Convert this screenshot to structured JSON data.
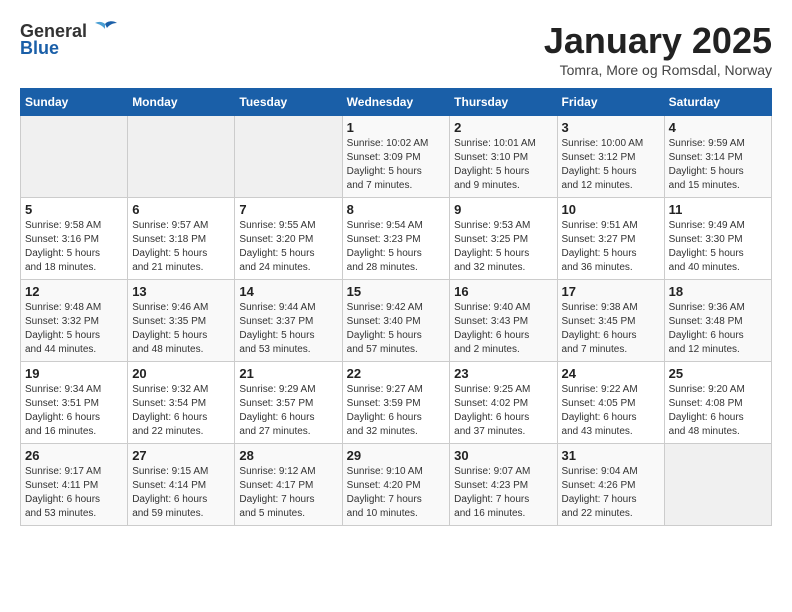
{
  "logo": {
    "general": "General",
    "blue": "Blue"
  },
  "title": "January 2025",
  "location": "Tomra, More og Romsdal, Norway",
  "days_header": [
    "Sunday",
    "Monday",
    "Tuesday",
    "Wednesday",
    "Thursday",
    "Friday",
    "Saturday"
  ],
  "weeks": [
    [
      {
        "day": "",
        "info": ""
      },
      {
        "day": "",
        "info": ""
      },
      {
        "day": "",
        "info": ""
      },
      {
        "day": "1",
        "info": "Sunrise: 10:02 AM\nSunset: 3:09 PM\nDaylight: 5 hours\nand 7 minutes."
      },
      {
        "day": "2",
        "info": "Sunrise: 10:01 AM\nSunset: 3:10 PM\nDaylight: 5 hours\nand 9 minutes."
      },
      {
        "day": "3",
        "info": "Sunrise: 10:00 AM\nSunset: 3:12 PM\nDaylight: 5 hours\nand 12 minutes."
      },
      {
        "day": "4",
        "info": "Sunrise: 9:59 AM\nSunset: 3:14 PM\nDaylight: 5 hours\nand 15 minutes."
      }
    ],
    [
      {
        "day": "5",
        "info": "Sunrise: 9:58 AM\nSunset: 3:16 PM\nDaylight: 5 hours\nand 18 minutes."
      },
      {
        "day": "6",
        "info": "Sunrise: 9:57 AM\nSunset: 3:18 PM\nDaylight: 5 hours\nand 21 minutes."
      },
      {
        "day": "7",
        "info": "Sunrise: 9:55 AM\nSunset: 3:20 PM\nDaylight: 5 hours\nand 24 minutes."
      },
      {
        "day": "8",
        "info": "Sunrise: 9:54 AM\nSunset: 3:23 PM\nDaylight: 5 hours\nand 28 minutes."
      },
      {
        "day": "9",
        "info": "Sunrise: 9:53 AM\nSunset: 3:25 PM\nDaylight: 5 hours\nand 32 minutes."
      },
      {
        "day": "10",
        "info": "Sunrise: 9:51 AM\nSunset: 3:27 PM\nDaylight: 5 hours\nand 36 minutes."
      },
      {
        "day": "11",
        "info": "Sunrise: 9:49 AM\nSunset: 3:30 PM\nDaylight: 5 hours\nand 40 minutes."
      }
    ],
    [
      {
        "day": "12",
        "info": "Sunrise: 9:48 AM\nSunset: 3:32 PM\nDaylight: 5 hours\nand 44 minutes."
      },
      {
        "day": "13",
        "info": "Sunrise: 9:46 AM\nSunset: 3:35 PM\nDaylight: 5 hours\nand 48 minutes."
      },
      {
        "day": "14",
        "info": "Sunrise: 9:44 AM\nSunset: 3:37 PM\nDaylight: 5 hours\nand 53 minutes."
      },
      {
        "day": "15",
        "info": "Sunrise: 9:42 AM\nSunset: 3:40 PM\nDaylight: 5 hours\nand 57 minutes."
      },
      {
        "day": "16",
        "info": "Sunrise: 9:40 AM\nSunset: 3:43 PM\nDaylight: 6 hours\nand 2 minutes."
      },
      {
        "day": "17",
        "info": "Sunrise: 9:38 AM\nSunset: 3:45 PM\nDaylight: 6 hours\nand 7 minutes."
      },
      {
        "day": "18",
        "info": "Sunrise: 9:36 AM\nSunset: 3:48 PM\nDaylight: 6 hours\nand 12 minutes."
      }
    ],
    [
      {
        "day": "19",
        "info": "Sunrise: 9:34 AM\nSunset: 3:51 PM\nDaylight: 6 hours\nand 16 minutes."
      },
      {
        "day": "20",
        "info": "Sunrise: 9:32 AM\nSunset: 3:54 PM\nDaylight: 6 hours\nand 22 minutes."
      },
      {
        "day": "21",
        "info": "Sunrise: 9:29 AM\nSunset: 3:57 PM\nDaylight: 6 hours\nand 27 minutes."
      },
      {
        "day": "22",
        "info": "Sunrise: 9:27 AM\nSunset: 3:59 PM\nDaylight: 6 hours\nand 32 minutes."
      },
      {
        "day": "23",
        "info": "Sunrise: 9:25 AM\nSunset: 4:02 PM\nDaylight: 6 hours\nand 37 minutes."
      },
      {
        "day": "24",
        "info": "Sunrise: 9:22 AM\nSunset: 4:05 PM\nDaylight: 6 hours\nand 43 minutes."
      },
      {
        "day": "25",
        "info": "Sunrise: 9:20 AM\nSunset: 4:08 PM\nDaylight: 6 hours\nand 48 minutes."
      }
    ],
    [
      {
        "day": "26",
        "info": "Sunrise: 9:17 AM\nSunset: 4:11 PM\nDaylight: 6 hours\nand 53 minutes."
      },
      {
        "day": "27",
        "info": "Sunrise: 9:15 AM\nSunset: 4:14 PM\nDaylight: 6 hours\nand 59 minutes."
      },
      {
        "day": "28",
        "info": "Sunrise: 9:12 AM\nSunset: 4:17 PM\nDaylight: 7 hours\nand 5 minutes."
      },
      {
        "day": "29",
        "info": "Sunrise: 9:10 AM\nSunset: 4:20 PM\nDaylight: 7 hours\nand 10 minutes."
      },
      {
        "day": "30",
        "info": "Sunrise: 9:07 AM\nSunset: 4:23 PM\nDaylight: 7 hours\nand 16 minutes."
      },
      {
        "day": "31",
        "info": "Sunrise: 9:04 AM\nSunset: 4:26 PM\nDaylight: 7 hours\nand 22 minutes."
      },
      {
        "day": "",
        "info": ""
      }
    ]
  ]
}
